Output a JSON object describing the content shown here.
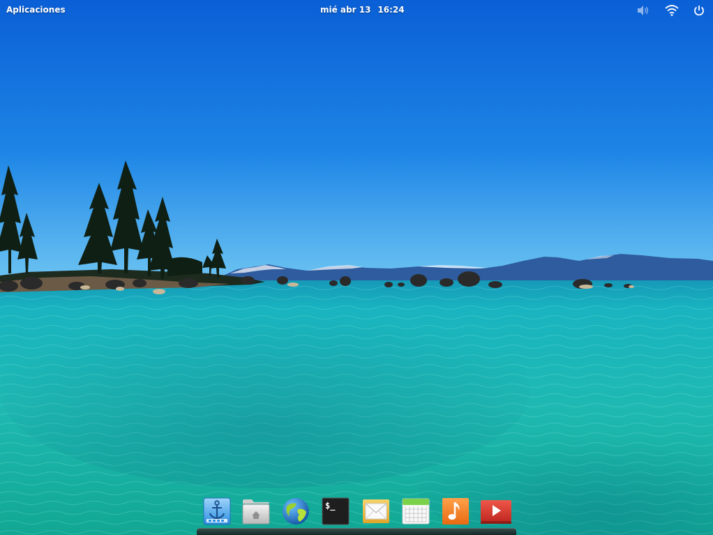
{
  "panel": {
    "applications_label": "Aplicaciones",
    "date": "mié abr 13",
    "time": "16:24",
    "indicators": [
      "volume-icon",
      "wifi-icon",
      "power-icon"
    ]
  },
  "dock": {
    "items": [
      {
        "icon": "plank-anchor-icon"
      },
      {
        "icon": "files-folder-icon"
      },
      {
        "icon": "web-browser-globe-icon"
      },
      {
        "icon": "terminal-icon",
        "glyph": "$_"
      },
      {
        "icon": "mail-envelope-icon"
      },
      {
        "icon": "calendar-icon"
      },
      {
        "icon": "music-note-icon"
      },
      {
        "icon": "videos-play-icon"
      }
    ]
  },
  "colors": {
    "sky_top": "#0a5fd6",
    "sky_horizon": "#4aa8f0",
    "water": "#1fb7b0",
    "panel_text": "#ffffff"
  }
}
